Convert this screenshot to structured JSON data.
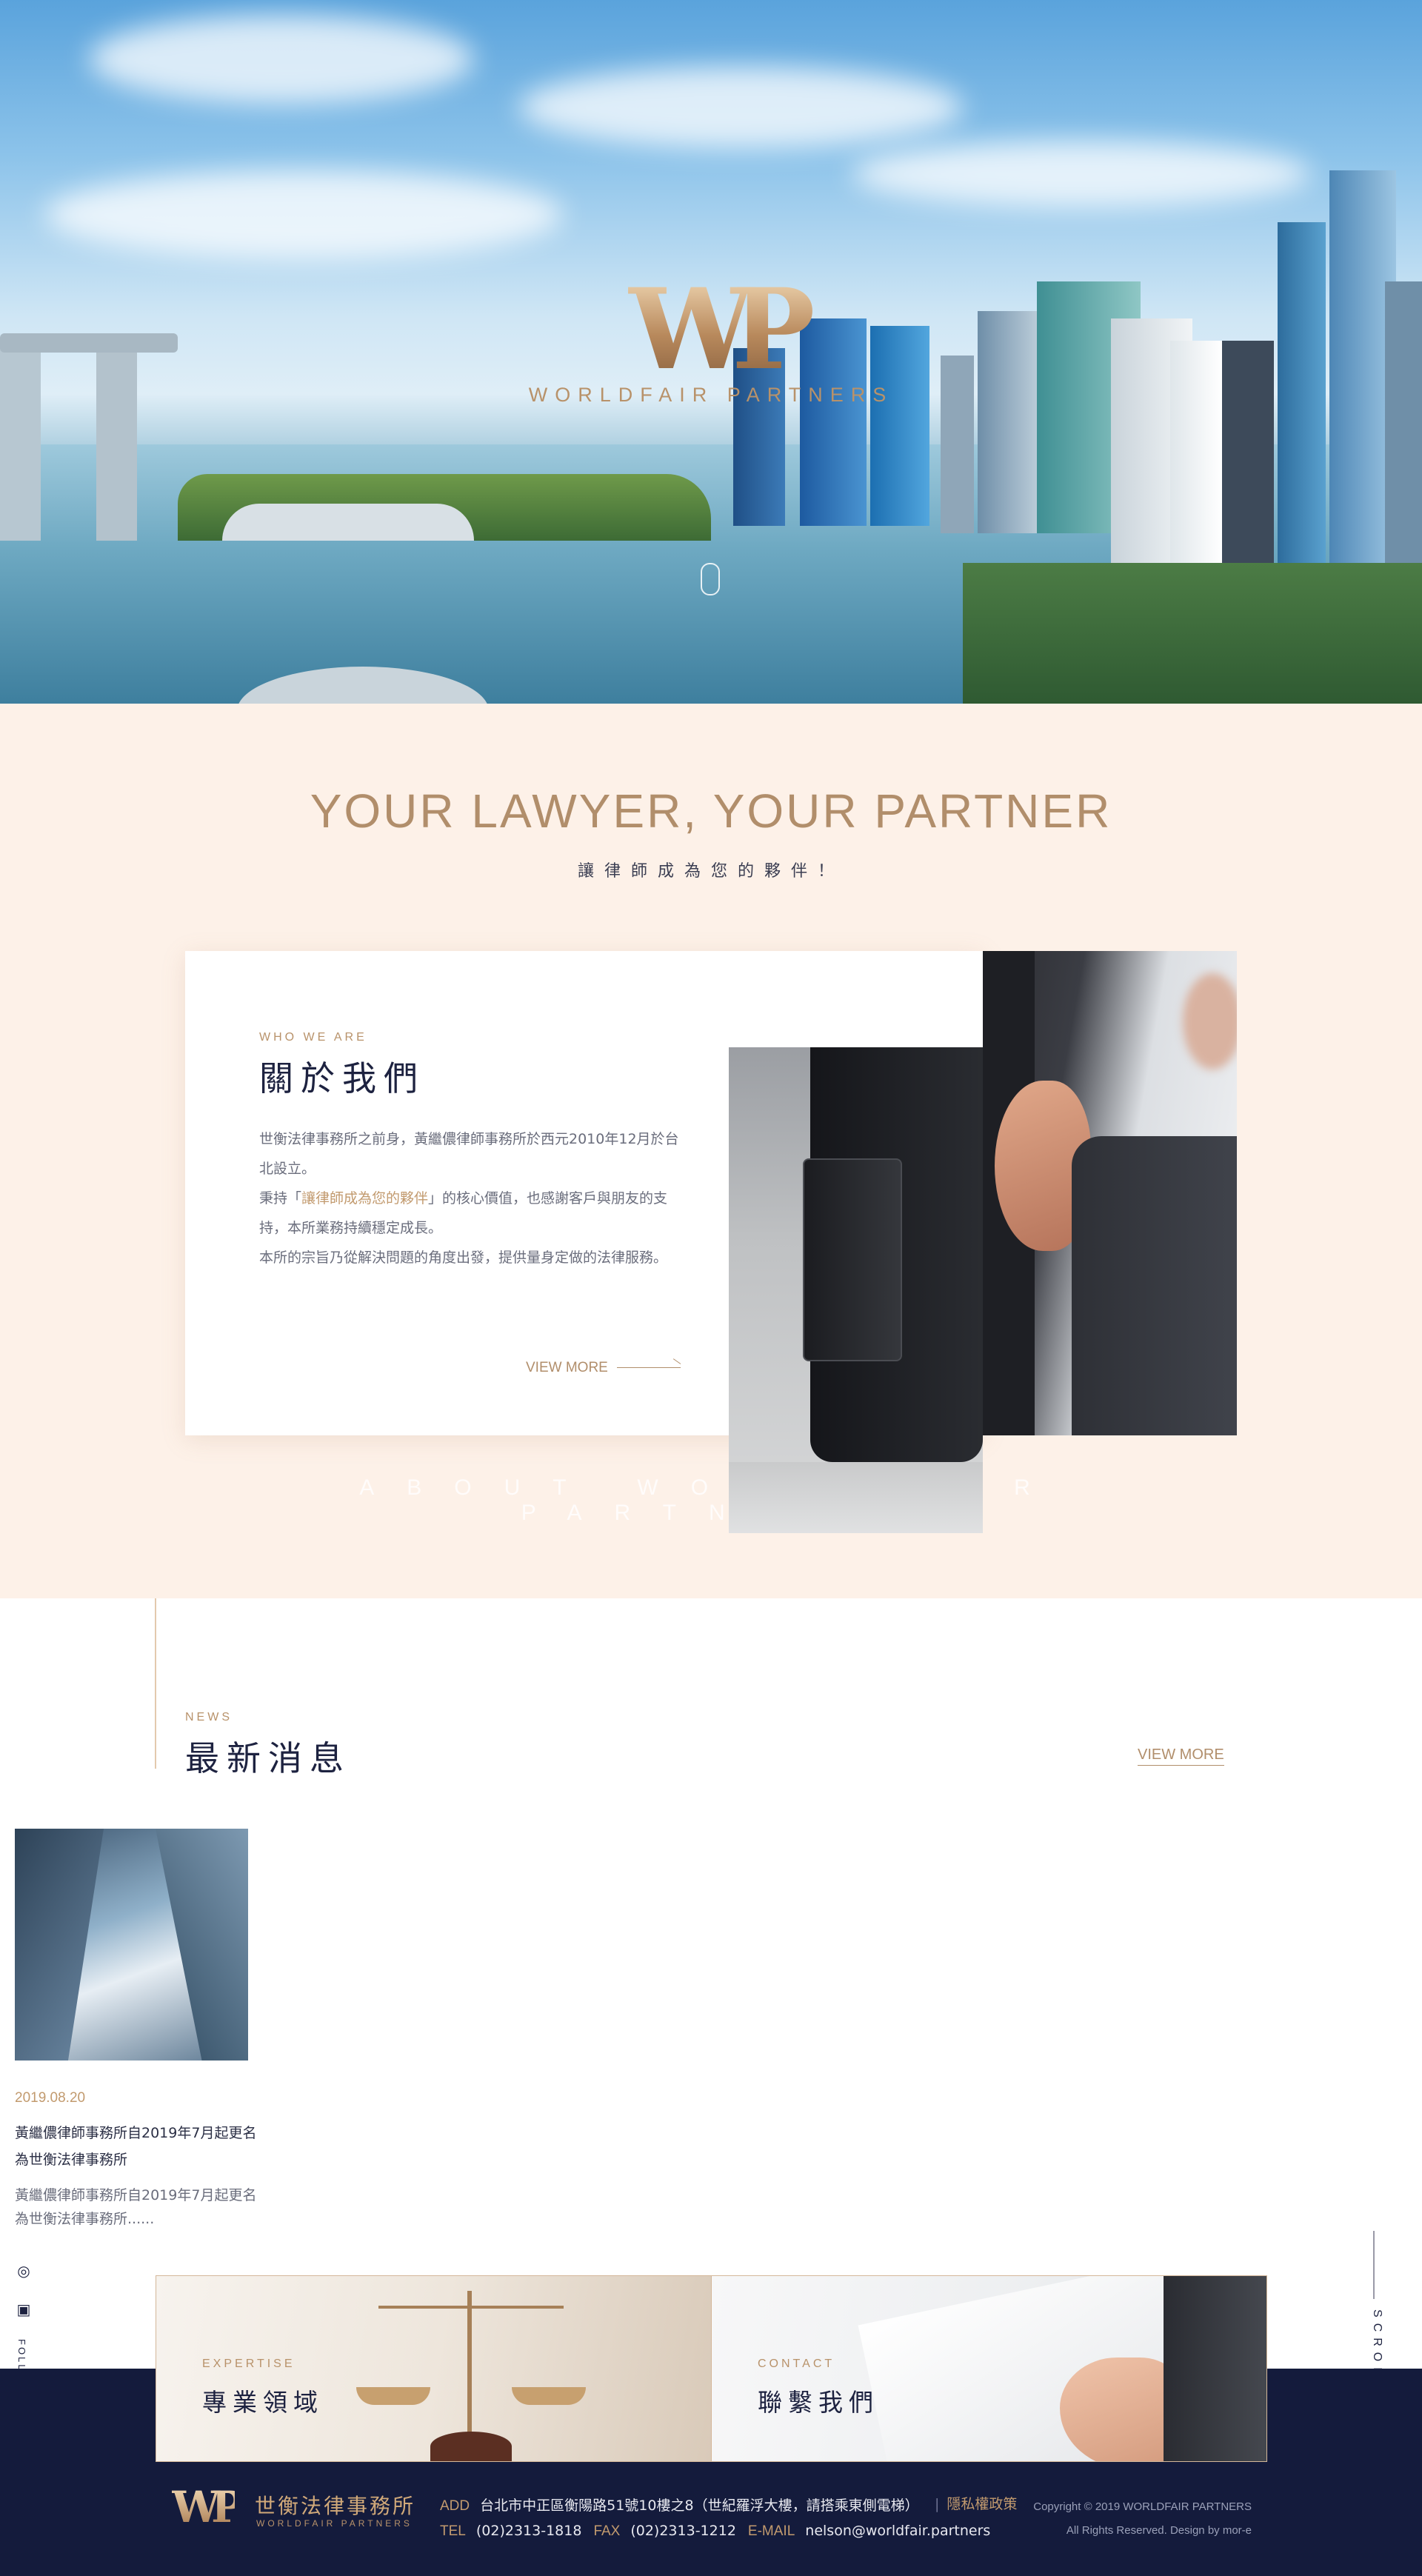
{
  "hero": {
    "logo_mark": "WP",
    "logo_name": "WORLDFAIR PARTNERS"
  },
  "intro": {
    "headline": "YOUR LAWYER, YOUR PARTNER",
    "subline": "讓律師成為您的夥伴！"
  },
  "about": {
    "kicker": "WHO WE ARE",
    "title": "關於我們",
    "p1": "世衡法律事務所之前身，黃繼儂律師事務所於西元2010年12月於台北設立。",
    "p2_pre": "秉持「",
    "p2_highlight": "讓律師成為您的夥伴",
    "p2_post": "」的核心價值，也感謝客戶與朋友的支持，本所業務持續穩定成長。",
    "p3": "本所的宗旨乃從解決問題的角度出發，提供量身定做的法律服務。",
    "view_more": "VIEW MORE",
    "watermark": "ABOUT WORLDFAIR PARTNERS"
  },
  "news": {
    "kicker": "NEWS",
    "title": "最新消息",
    "view_more": "VIEW MORE",
    "items": [
      {
        "date": "2019.08.20",
        "title": "黃繼儂律師事務所自2019年7月起更名為世衡法律事務所",
        "excerpt": "黃繼儂律師事務所自2019年7月起更名為世衡法律事務所......"
      }
    ]
  },
  "side": {
    "follow_label": "FOLLOW",
    "scroll_label": "SCROLL"
  },
  "panels": {
    "expertise_kicker": "EXPERTISE",
    "expertise_title": "專業領域",
    "contact_kicker": "CONTACT",
    "contact_title": "聯繫我們"
  },
  "footer": {
    "brand_mark": "WP",
    "brand_cn": "世衡法律事務所",
    "brand_en": "WORLDFAIR PARTNERS",
    "add_label": "ADD",
    "address": "台北市中正區衡陽路51號10樓之8（世紀羅浮大樓，請搭乘東側電梯）",
    "privacy": "隱私權政策",
    "tel_label": "TEL",
    "tel": "(02)2313-1818",
    "fax_label": "FAX",
    "fax": "(02)2313-1212",
    "email_label": "E-MAIL",
    "email": "nelson@worldfair.partners",
    "copyright": "Copyright © 2019 WORLDFAIR PARTNERS",
    "rights": "All Rights Reserved. Design by mor-e"
  },
  "colors": {
    "accent_gold": "#b18e6b",
    "cream_bg": "#fdf1e8",
    "navy": "#141b3c"
  }
}
